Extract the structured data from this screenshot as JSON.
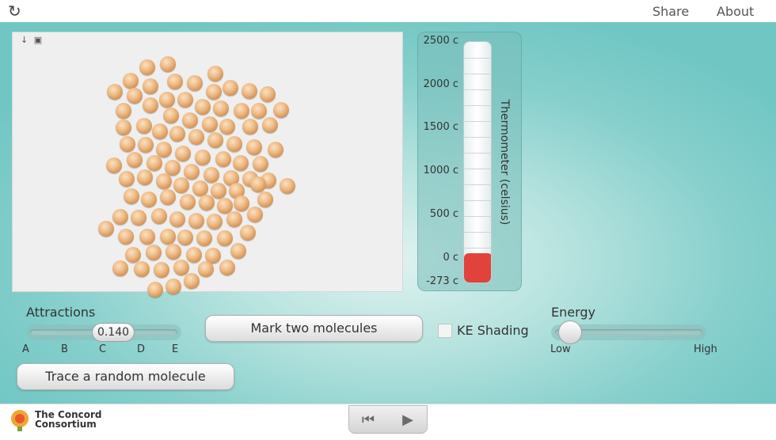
{
  "topbar": {
    "reload_icon": "reload-icon",
    "share_label": "Share",
    "about_label": "About"
  },
  "simulation": {
    "icons": {
      "thermometer": "thermometer-icon",
      "lock": "lock-icon"
    },
    "molecule_color": "#e8aa6e"
  },
  "thermometer": {
    "title": "Thermometer (celsius)",
    "scale": [
      "2500 c",
      "2000 c",
      "1500 c",
      "1000 c",
      "500 c",
      "0 c",
      "-273 c"
    ],
    "fill_color": "#e2423c",
    "temperature_fraction": 0.12
  },
  "attractions": {
    "label": "Attractions",
    "value": "0.140",
    "ticks": [
      "A",
      "B",
      "C",
      "D",
      "E"
    ],
    "position_fraction": 0.5
  },
  "energy": {
    "label": "Energy",
    "low_label": "Low",
    "high_label": "High",
    "position_fraction": 0.1
  },
  "buttons": {
    "mark_two": "Mark two molecules",
    "trace_random": "Trace a random molecule"
  },
  "ke_shading": {
    "label": "KE Shading",
    "checked": false
  },
  "footer": {
    "logo_line1": "The Concord",
    "logo_line2": "Consortium",
    "rewind_icon": "rewind-icon",
    "play_icon": "play-icon"
  }
}
